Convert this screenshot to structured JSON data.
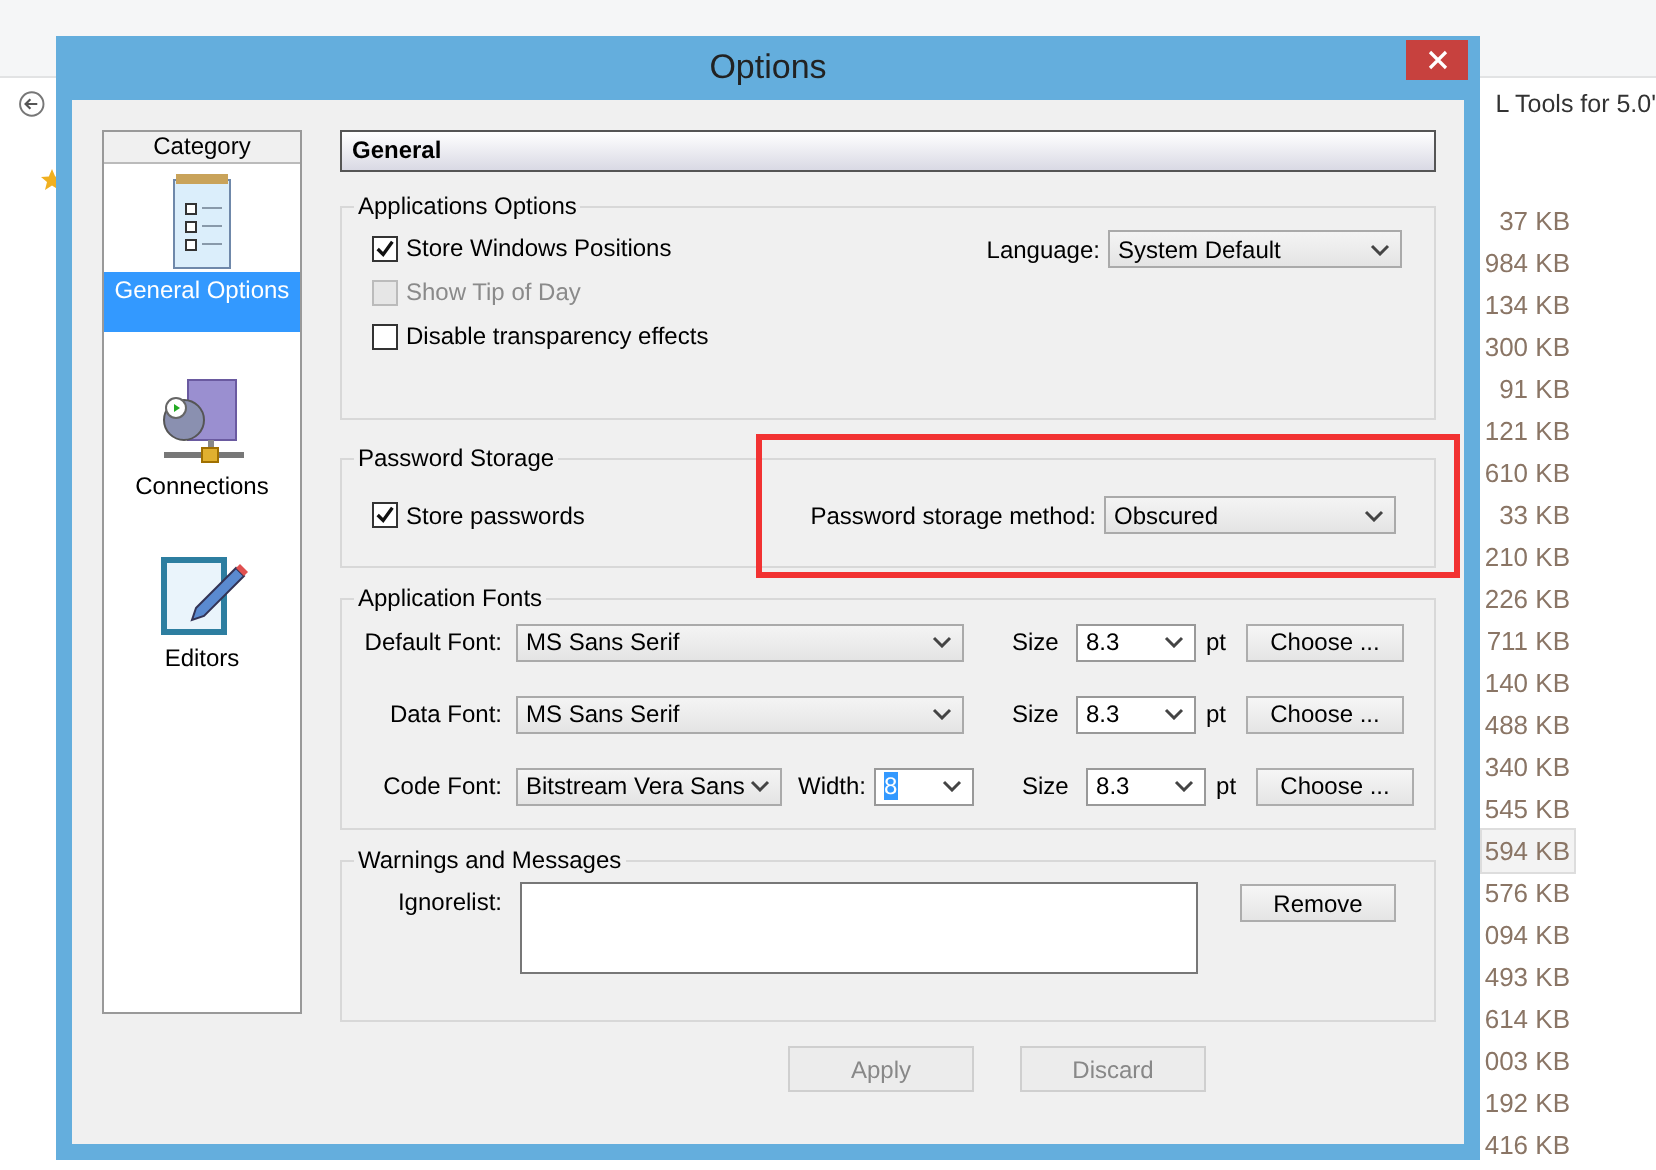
{
  "background": {
    "path_text": "L Tools for 5.0'",
    "sizes": [
      {
        "text": "37 KB",
        "selected": false
      },
      {
        "text": "984 KB",
        "selected": false
      },
      {
        "text": "134 KB",
        "selected": false
      },
      {
        "text": "300 KB",
        "selected": false
      },
      {
        "text": "91 KB",
        "selected": false
      },
      {
        "text": "121 KB",
        "selected": false
      },
      {
        "text": "610 KB",
        "selected": false
      },
      {
        "text": "33 KB",
        "selected": false
      },
      {
        "text": "210 KB",
        "selected": false
      },
      {
        "text": "226 KB",
        "selected": false
      },
      {
        "text": "711 KB",
        "selected": false
      },
      {
        "text": "140 KB",
        "selected": false
      },
      {
        "text": "488 KB",
        "selected": false
      },
      {
        "text": "340 KB",
        "selected": false
      },
      {
        "text": "545 KB",
        "selected": false
      },
      {
        "text": "594 KB",
        "selected": true
      },
      {
        "text": "576 KB",
        "selected": false
      },
      {
        "text": "094 KB",
        "selected": false
      },
      {
        "text": "493 KB",
        "selected": false
      },
      {
        "text": "614 KB",
        "selected": false
      },
      {
        "text": "003 KB",
        "selected": false
      },
      {
        "text": "192 KB",
        "selected": false
      },
      {
        "text": "416 KB",
        "selected": false
      }
    ]
  },
  "window": {
    "title": "Options"
  },
  "category": {
    "header": "Category",
    "items": [
      {
        "label": "General Options",
        "selected": true
      },
      {
        "label": "Connections",
        "selected": false
      },
      {
        "label": "Editors",
        "selected": false
      }
    ]
  },
  "page_title": "General",
  "applications_options": {
    "title": "Applications Options",
    "checkboxes": [
      {
        "label": "Store Windows Positions",
        "checked": true,
        "disabled": false
      },
      {
        "label": "Show Tip of Day",
        "checked": false,
        "disabled": true
      },
      {
        "label": "Disable transparency effects",
        "checked": false,
        "disabled": false
      }
    ],
    "language": {
      "label": "Language:",
      "value": "System Default"
    }
  },
  "password_storage": {
    "title": "Password Storage",
    "checkbox": {
      "label": "Store passwords",
      "checked": true,
      "disabled": false
    },
    "method": {
      "label": "Password storage method:",
      "value": "Obscured"
    }
  },
  "application_fonts": {
    "title": "Application Fonts",
    "rows": [
      {
        "label": "Default Font:",
        "value": "MS Sans Serif",
        "size_label": "Size",
        "size": "8.3",
        "unit": "pt",
        "button": "Choose ..."
      },
      {
        "label": "Data Font:",
        "value": "MS Sans Serif",
        "size_label": "Size",
        "size": "8.3",
        "unit": "pt",
        "button": "Choose ..."
      },
      {
        "label": "Code Font:",
        "value": "Bitstream Vera Sans",
        "width": {
          "label": "Width:",
          "value": "8",
          "text_selected": true
        },
        "size_label": "Size",
        "size": "8.3",
        "unit": "pt",
        "button": "Choose ..."
      }
    ]
  },
  "warnings": {
    "title": "Warnings and Messages",
    "ignorelist_label": "Ignorelist:",
    "remove_button": "Remove"
  },
  "buttons": [
    {
      "label": "Apply",
      "disabled": true
    },
    {
      "label": "Discard",
      "disabled": true
    }
  ]
}
